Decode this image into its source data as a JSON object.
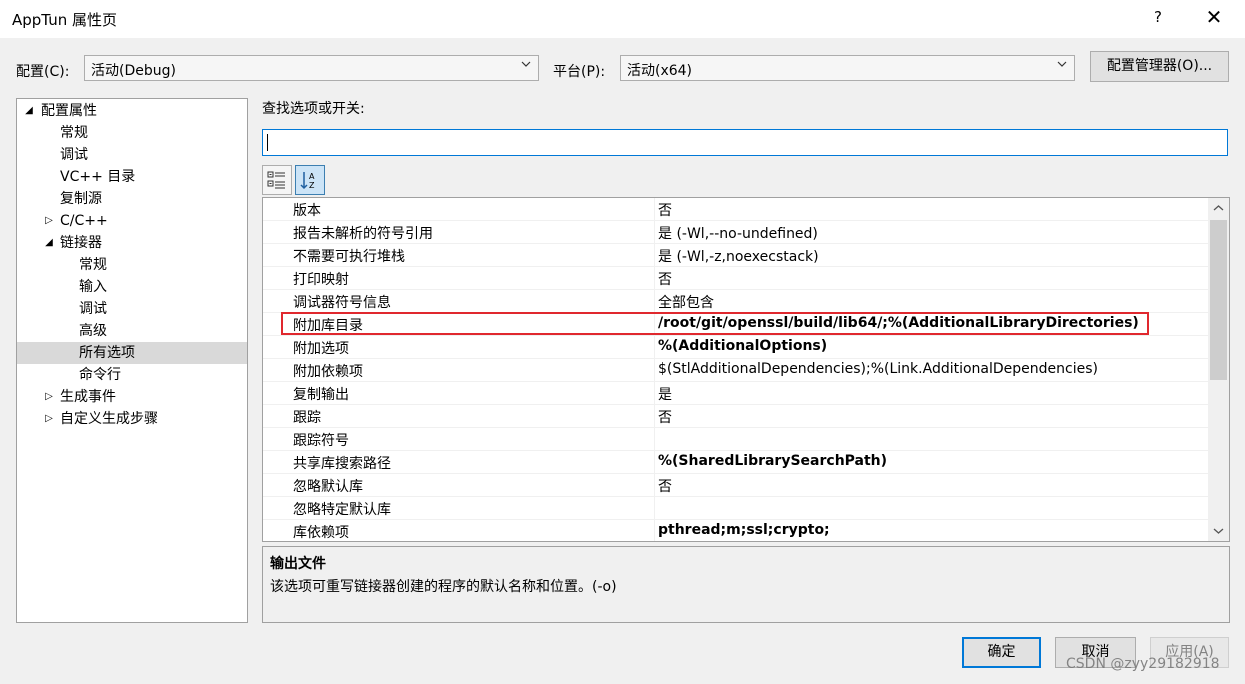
{
  "window": {
    "title": "AppTun 属性页",
    "help": "?",
    "close": "✕"
  },
  "config": {
    "label": "配置(C):",
    "value": "活动(Debug)",
    "platform_label": "平台(P):",
    "platform_value": "活动(x64)",
    "manager_button": "配置管理器(O)..."
  },
  "tree": [
    {
      "label": "配置属性",
      "expander": "◢"
    },
    {
      "label": "常规"
    },
    {
      "label": "调试"
    },
    {
      "label": "VC++ 目录"
    },
    {
      "label": "复制源"
    },
    {
      "label": "C/C++",
      "expander": "▷"
    },
    {
      "label": "链接器",
      "expander": "◢"
    },
    {
      "label": "常规"
    },
    {
      "label": "输入"
    },
    {
      "label": "调试"
    },
    {
      "label": "高级"
    },
    {
      "label": "所有选项"
    },
    {
      "label": "命令行"
    },
    {
      "label": "生成事件",
      "expander": "▷"
    },
    {
      "label": "自定义生成步骤",
      "expander": "▷"
    }
  ],
  "search": {
    "label": "查找选项或开关:",
    "value": ""
  },
  "grid": [
    {
      "name": "版本",
      "value": "否"
    },
    {
      "name": "报告未解析的符号引用",
      "value": "是 (-Wl,--no-undefined)"
    },
    {
      "name": "不需要可执行堆栈",
      "value": "是 (-Wl,-z,noexecstack)"
    },
    {
      "name": "打印映射",
      "value": "否"
    },
    {
      "name": "调试器符号信息",
      "value": "全部包含"
    },
    {
      "name": "附加库目录",
      "value": "/root/git/openssl/build/lib64/;%(AdditionalLibraryDirectories)"
    },
    {
      "name": "附加选项",
      "value": "%(AdditionalOptions)"
    },
    {
      "name": "附加依赖项",
      "value": "$(StlAdditionalDependencies);%(Link.AdditionalDependencies)"
    },
    {
      "name": "复制输出",
      "value": "是"
    },
    {
      "name": "跟踪",
      "value": "否"
    },
    {
      "name": "跟踪符号",
      "value": ""
    },
    {
      "name": "共享库搜索路径",
      "value": "%(SharedLibrarySearchPath)"
    },
    {
      "name": "忽略默认库",
      "value": "否"
    },
    {
      "name": "忽略特定默认库",
      "value": ""
    },
    {
      "name": "库依赖项",
      "value": "pthread;m;ssl;crypto;"
    }
  ],
  "description": {
    "title": "输出文件",
    "text": "该选项可重写链接器创建的程序的默认名称和位置。(-o)"
  },
  "buttons": {
    "ok": "确定",
    "cancel": "取消",
    "apply": "应用(A)"
  },
  "watermark": "CSDN @zyy29182918"
}
